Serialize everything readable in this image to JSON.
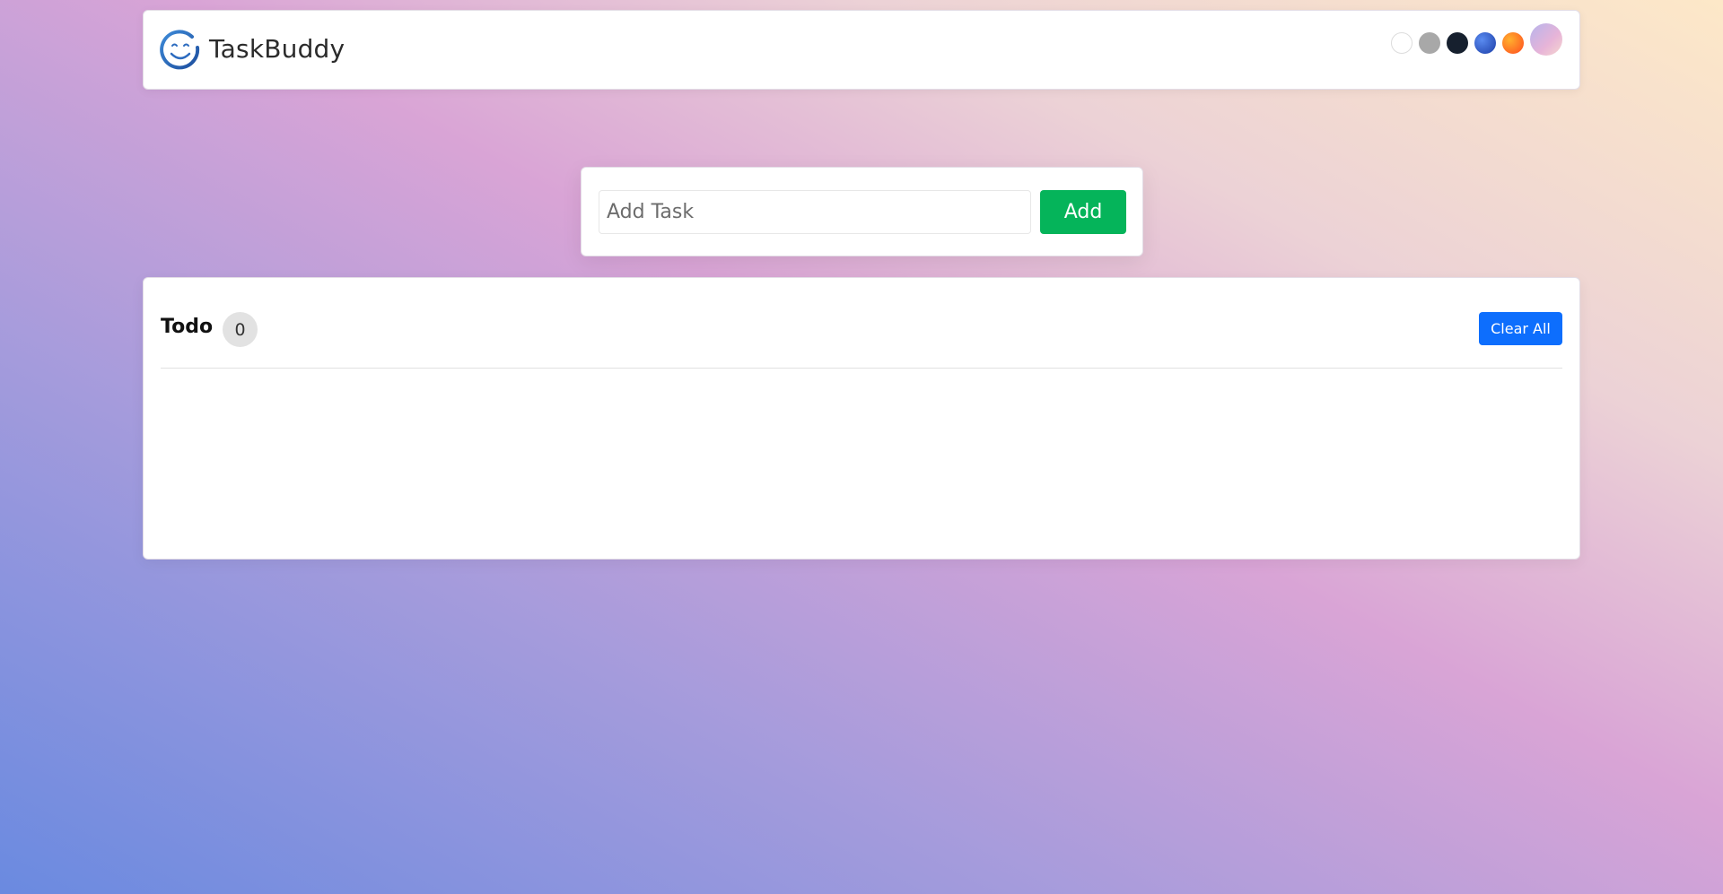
{
  "header": {
    "brand": "TaskBuddy",
    "logo_icon": "smiley-logo-icon",
    "themes": [
      {
        "name": "white",
        "color": "#ffffff"
      },
      {
        "name": "gray",
        "color": "#a8a8a8"
      },
      {
        "name": "dark",
        "color": "#16202e"
      },
      {
        "name": "blue",
        "color": "#2f5fd0"
      },
      {
        "name": "orange",
        "color": "#ff6a1a"
      },
      {
        "name": "gradient",
        "color": "#d8b0e0"
      }
    ]
  },
  "input": {
    "placeholder": "Add Task",
    "value": "",
    "add_label": "Add",
    "add_color": "#05b45a"
  },
  "todo": {
    "title": "Todo",
    "count": "0",
    "clear_label": "Clear All",
    "clear_color": "#0d6efd",
    "items": []
  }
}
